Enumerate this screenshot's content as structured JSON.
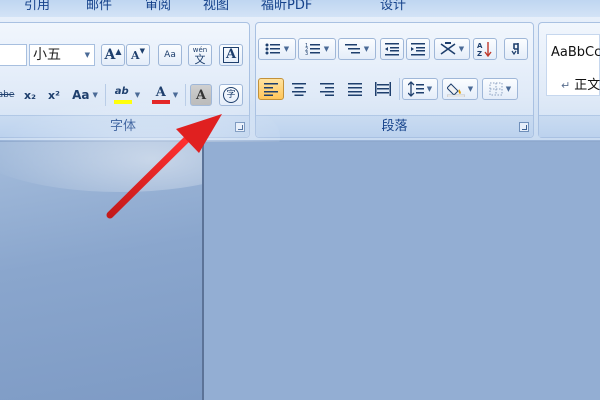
{
  "tabs": [
    "引用",
    "邮件",
    "审阅",
    "视图",
    "福昕PDF",
    "设计"
  ],
  "font_group": {
    "label": "字体",
    "font_size_value": "小五",
    "buttons": {
      "grow_font": "A",
      "shrink_font": "A",
      "clear_format": "Aa",
      "phonetic": "wén",
      "phonetic_char": "文",
      "char_border": "A",
      "strikethrough": "abe",
      "subscript": "x₂",
      "superscript": "x²",
      "change_case": "Aa",
      "highlight": "ab",
      "font_color": "A",
      "char_shading": "A",
      "enclose_char": "字"
    },
    "colors": {
      "highlight": "#ffff00",
      "font_color": "#e21b1b"
    }
  },
  "paragraph_group": {
    "label": "段落"
  },
  "styles_group": {
    "style_preview": "AaBbCc",
    "style_name": "正文"
  },
  "annotation": {
    "arrow_color": "#e02020"
  }
}
